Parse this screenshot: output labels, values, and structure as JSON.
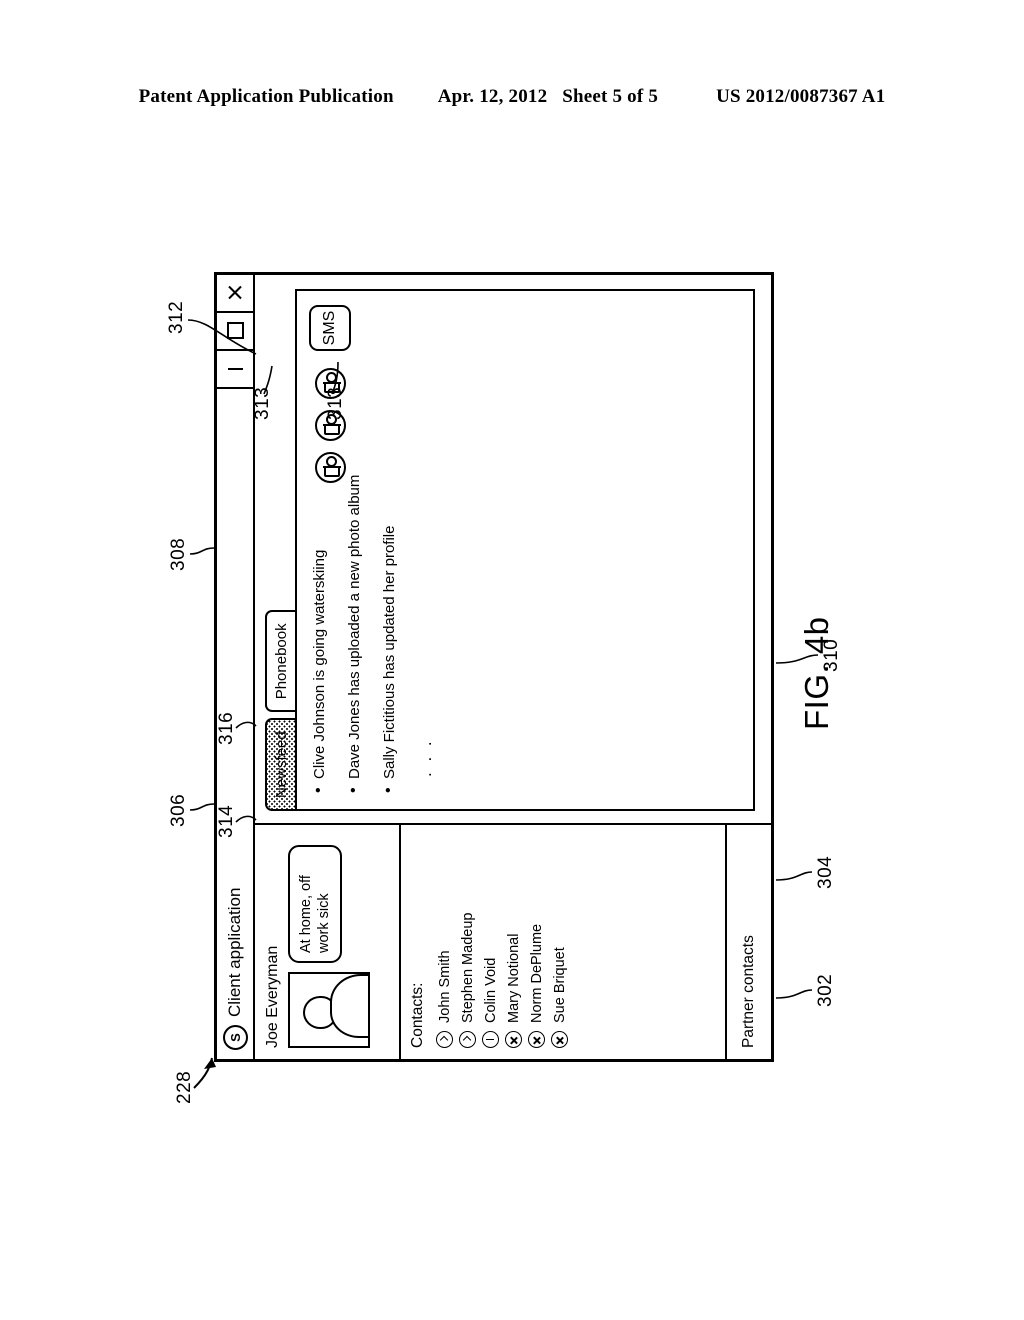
{
  "publication_header": {
    "left": "Patent Application Publication",
    "date": "Apr. 12, 2012",
    "sheet": "Sheet 5 of 5",
    "number": "US 2012/0087367 A1"
  },
  "figure": {
    "caption": "FIG. 4b",
    "reference_numerals": {
      "window_pointer": "228",
      "profile_panel": "302",
      "contacts_panel": "304",
      "titlebar": "306",
      "tabstrip_area": "308",
      "partner_contacts": "310",
      "content_pane": "312",
      "action_icons_a": "313",
      "action_icons_b": "313",
      "tab_newsfeed": "314",
      "tab_phonebook": "316"
    }
  },
  "window": {
    "logo_glyph": "S",
    "title": "Client application",
    "controls": [
      {
        "name": "minimize",
        "glyph": "|"
      },
      {
        "name": "maximize",
        "glyph": "□"
      },
      {
        "name": "close",
        "glyph": "✕"
      }
    ]
  },
  "profile": {
    "name": "Joe Everyman",
    "status_message": "At home, off work sick",
    "avatar_alt": "user avatar silhouette"
  },
  "contacts": {
    "label": "Contacts:",
    "items": [
      {
        "name": "John Smith",
        "status": "available"
      },
      {
        "name": "Stephen Madeup",
        "status": "available"
      },
      {
        "name": "Colin Void",
        "status": "away"
      },
      {
        "name": "Mary Notional",
        "status": "offline"
      },
      {
        "name": "Norm DePlume",
        "status": "offline"
      },
      {
        "name": "Sue Briquet",
        "status": "offline"
      }
    ]
  },
  "partner_contacts": {
    "label": "Partner contacts"
  },
  "tabs": [
    {
      "label": "Newsfeed",
      "selected": true
    },
    {
      "label": "Phonebook",
      "selected": false
    }
  ],
  "newsfeed": {
    "bullet": "•",
    "items": [
      "Clive Johnson is going waterskiing",
      "Dave Jones has uploaded a new photo album",
      "Sally Fictitious has updated her profile"
    ],
    "ellipsis": ". . ."
  },
  "actions": {
    "person_icons": [
      {
        "name": "contact-action-icon-1"
      },
      {
        "name": "contact-action-icon-2"
      },
      {
        "name": "contact-action-icon-3"
      }
    ],
    "sms_label": "SMS"
  }
}
